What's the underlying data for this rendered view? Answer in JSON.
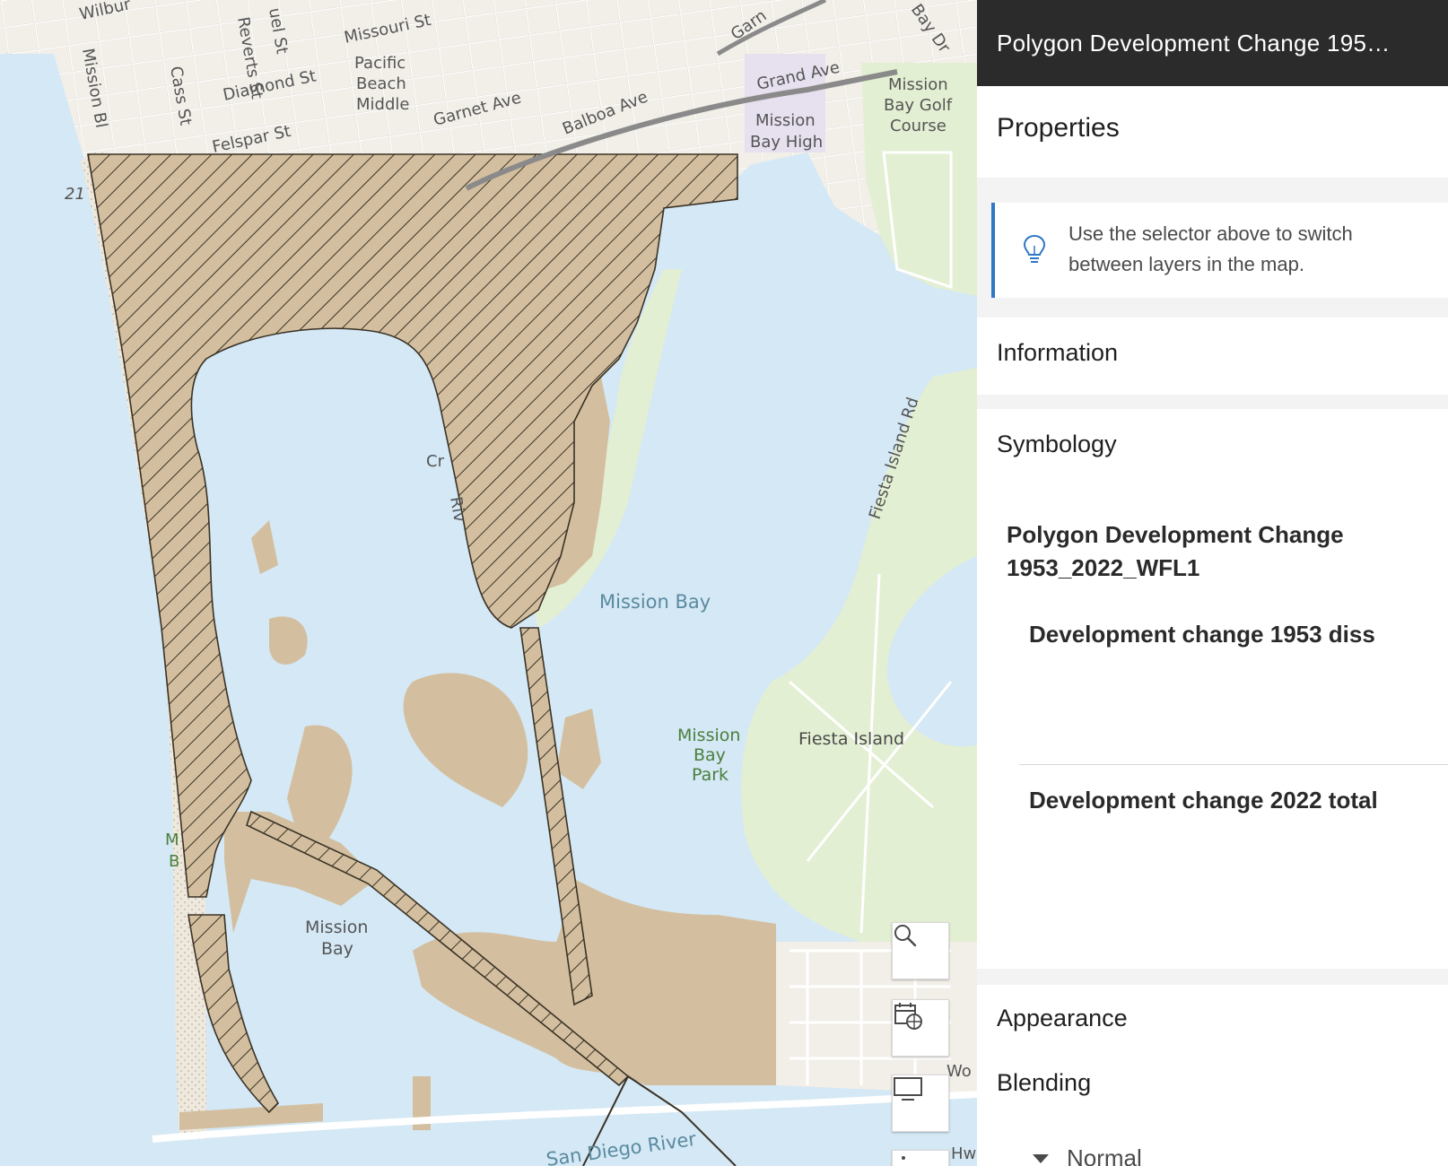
{
  "panel": {
    "title": "Polygon Development Change 195…",
    "properties_label": "Properties",
    "tip_text": "Use the selector above to switch between layers in the map.",
    "information_label": "Information",
    "symbology_label": "Symbology",
    "layer_name": "Polygon Development Change 1953_2022_WFL1",
    "legend": [
      {
        "label": "Development change 1953 diss",
        "symbol": "hatched-polygon"
      },
      {
        "label": "Development change 2022 total",
        "symbol": "solid-polygon",
        "color": "#d3bf9f"
      }
    ],
    "appearance_label": "Appearance",
    "blending_label": "Blending",
    "blending_value": "Normal"
  },
  "map": {
    "labels": {
      "wilbur": "Wilbur",
      "missouri": "Missouri St",
      "roberts": "Reverts St",
      "emerald": "uel St",
      "pacific_beach_middle_1": "Pacific",
      "pacific_beach_middle_2": "Beach",
      "pacific_beach_middle_3": "Middle",
      "diamond": "Diamond St",
      "cass": "Cass St",
      "mission_blvd": "Mission Bl",
      "felspar": "Felspar St",
      "garnet": "Garnet Ave",
      "balboa": "Balboa Ave",
      "grand": "Grand Ave",
      "garnet_ne": "Garn",
      "bay_dr": "Bay Dr",
      "mission_bay_high_1": "Mission",
      "mission_bay_high_2": "Bay High",
      "golf_1": "Mission",
      "golf_2": "Bay Golf",
      "golf_3": "Course",
      "route": "21",
      "mission_bay_center": "Mission Bay",
      "fiesta_island_rd": "Fiesta Island Rd",
      "mission_bay_park_1": "Mission",
      "mission_bay_park_2": "Bay",
      "mission_bay_park_3": "Park",
      "fiesta_island": "Fiesta Island",
      "mission_bay_sw_1": "Mission",
      "mission_bay_sw_2": "Bay",
      "san_diego_river": "San Diego River",
      "crown_point": "Cr",
      "riv": "Riv",
      "m_left": "M",
      "b_left": "B",
      "wo": "Wo",
      "hw": "Hw"
    },
    "colors": {
      "water": "#d4e8f5",
      "land": "#f2efe9",
      "park": "#e3efd3",
      "development": "#d3bf9f",
      "school": "#e6e0ef"
    },
    "tools": [
      "search-icon",
      "basemap-calendar-icon",
      "screen-icon",
      "more-icon"
    ]
  }
}
